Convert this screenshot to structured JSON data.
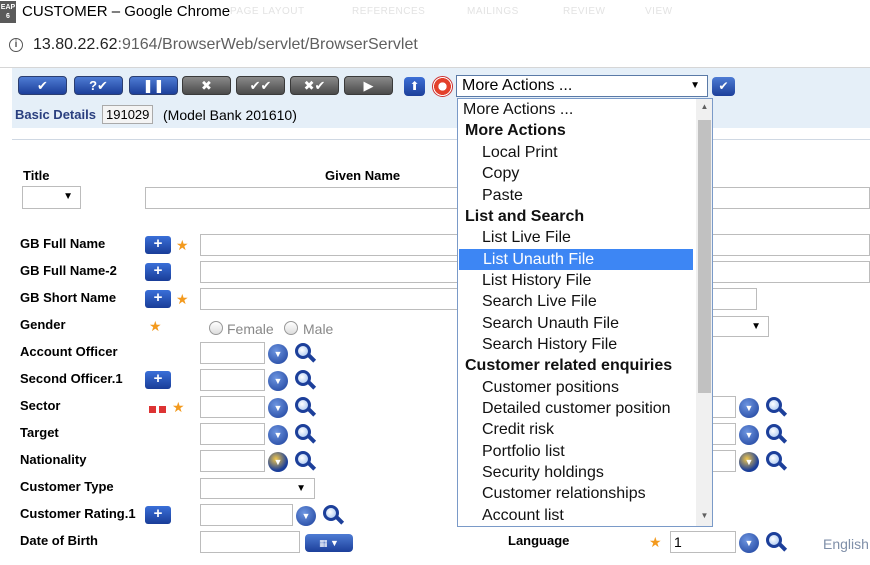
{
  "window": {
    "app_icon_text": "EAP\n6",
    "title": "CUSTOMER – Google Chrome",
    "ghost_tabs": [
      "PAGE LAYOUT",
      "REFERENCES",
      "MAILINGS",
      "REVIEW",
      "VIEW"
    ]
  },
  "address": {
    "host": "13.80.22.62",
    "path": ":9164/BrowserWeb/servlet/BrowserServlet"
  },
  "toolbar": {
    "buttons": [
      {
        "name": "commit-button",
        "glyph": "✔",
        "style": "blue"
      },
      {
        "name": "validate-button",
        "glyph": "?✔",
        "style": "blue"
      },
      {
        "name": "hold-button",
        "glyph": "❚❚",
        "style": "blue"
      },
      {
        "name": "delete-button",
        "glyph": "✖",
        "style": "gray"
      },
      {
        "name": "authorise-button",
        "glyph": "✔✔",
        "style": "gray"
      },
      {
        "name": "reverse-button",
        "glyph": "✖✔",
        "style": "gray"
      },
      {
        "name": "next-button",
        "glyph": "▶",
        "style": "gray"
      }
    ],
    "up_glyph": "⬆",
    "go_glyph": "✔",
    "actions_selected": "More Actions ...",
    "actions_arrow": "▼"
  },
  "record": {
    "section_label": "Basic Details",
    "id": "191029",
    "company": "(Model Bank 201610)"
  },
  "form": {
    "title_label": "Title",
    "given_name_label": "Given Name",
    "title_select_arrow": "▼",
    "fields": {
      "gb_full_name": "GB Full Name",
      "gb_full_name_2": "GB Full Name-2",
      "gb_short_name": "GB Short Name",
      "gender": "Gender",
      "account_officer": "Account Officer",
      "second_officer": "Second Officer.1",
      "sector": "Sector",
      "target": "Target",
      "nationality": "Nationality",
      "customer_type": "Customer Type",
      "customer_rating": "Customer Rating.1",
      "date_of_birth": "Date of Birth",
      "language": "Language"
    },
    "gender_options": {
      "female": "Female",
      "male": "Male"
    },
    "language_value": "1",
    "english_link": "English"
  },
  "actions_list": {
    "options": [
      {
        "text": "More Actions ...",
        "kind": "first"
      },
      {
        "text": "More Actions",
        "kind": "group"
      },
      {
        "text": "Local Print",
        "kind": "item"
      },
      {
        "text": "Copy",
        "kind": "item"
      },
      {
        "text": "Paste",
        "kind": "item"
      },
      {
        "text": "List and Search",
        "kind": "group"
      },
      {
        "text": "List Live File",
        "kind": "item"
      },
      {
        "text": "List Unauth File",
        "kind": "item",
        "selected": true
      },
      {
        "text": "List History File",
        "kind": "item"
      },
      {
        "text": "Search Live File",
        "kind": "item"
      },
      {
        "text": "Search Unauth File",
        "kind": "item"
      },
      {
        "text": "Search History File",
        "kind": "item"
      },
      {
        "text": "Customer related enquiries",
        "kind": "group"
      },
      {
        "text": "Customer positions",
        "kind": "item"
      },
      {
        "text": "Detailed customer position",
        "kind": "item"
      },
      {
        "text": "Credit risk",
        "kind": "item"
      },
      {
        "text": "Portfolio list",
        "kind": "item"
      },
      {
        "text": "Security holdings",
        "kind": "item"
      },
      {
        "text": "Customer relationships",
        "kind": "item"
      },
      {
        "text": "Account list",
        "kind": "item"
      }
    ]
  },
  "colors": {
    "accent": "#1c3f9a",
    "selected": "#3d86f4",
    "mandatory_star": "#f39a1e",
    "toolbar_bg": "#e5eff8"
  }
}
